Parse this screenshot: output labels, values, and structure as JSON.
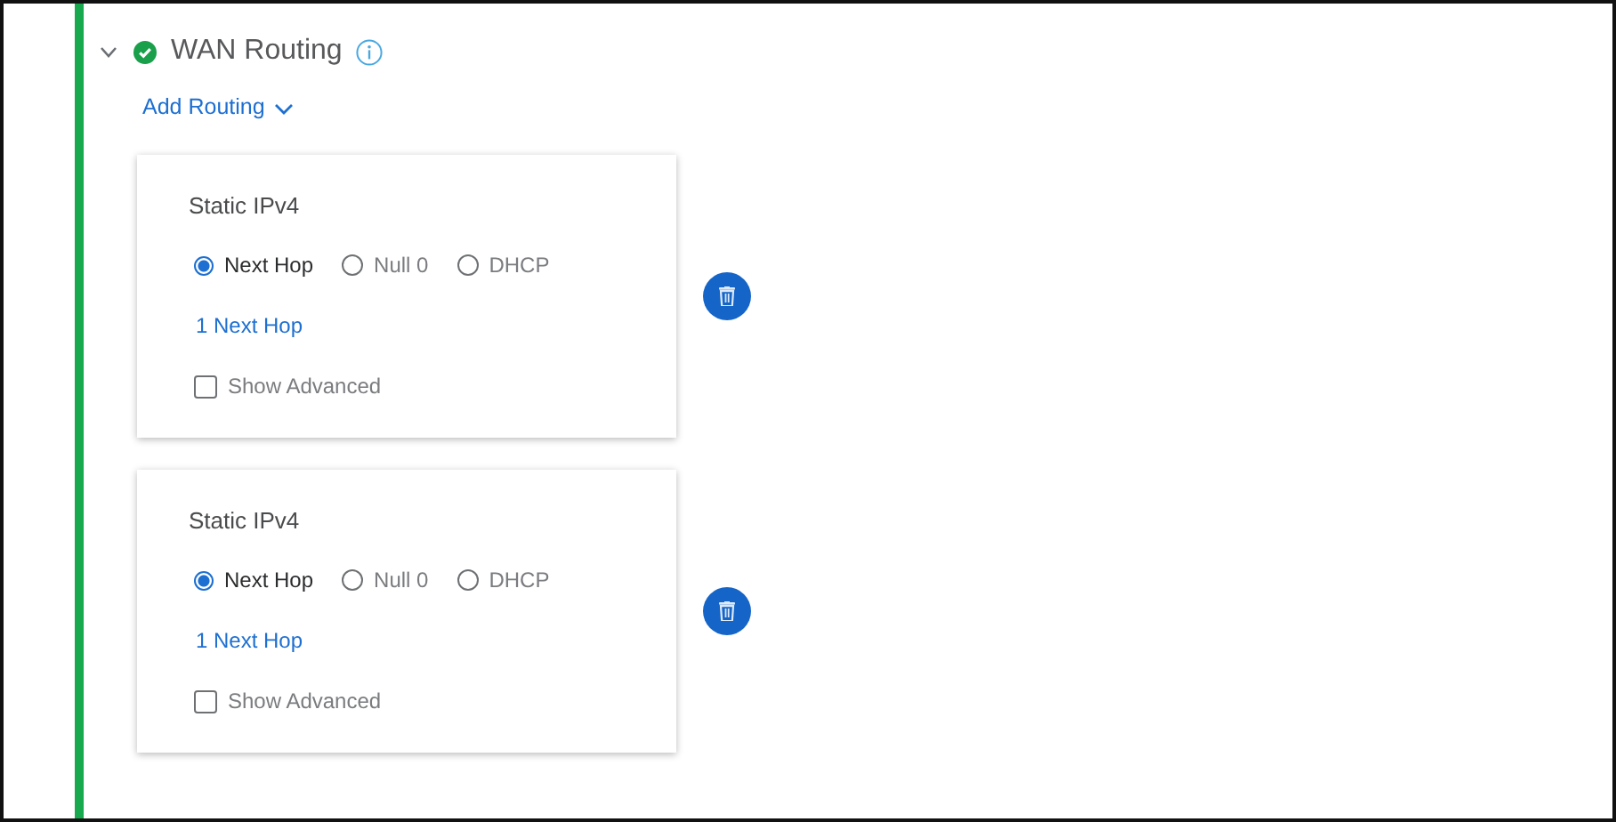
{
  "section": {
    "title": "WAN Routing",
    "expanded": true,
    "valid": true
  },
  "add_routing": {
    "label": "Add Routing"
  },
  "routes": [
    {
      "title": "Static IPv4",
      "options": [
        {
          "label": "Next Hop",
          "selected": true
        },
        {
          "label": "Null 0",
          "selected": false
        },
        {
          "label": "DHCP",
          "selected": false
        }
      ],
      "next_hop_link": "1 Next Hop",
      "advanced": {
        "label": "Show Advanced",
        "checked": false
      }
    },
    {
      "title": "Static IPv4",
      "options": [
        {
          "label": "Next Hop",
          "selected": true
        },
        {
          "label": "Null 0",
          "selected": false
        },
        {
          "label": "DHCP",
          "selected": false
        }
      ],
      "next_hop_link": "1 Next Hop",
      "advanced": {
        "label": "Show Advanced",
        "checked": false
      }
    }
  ]
}
